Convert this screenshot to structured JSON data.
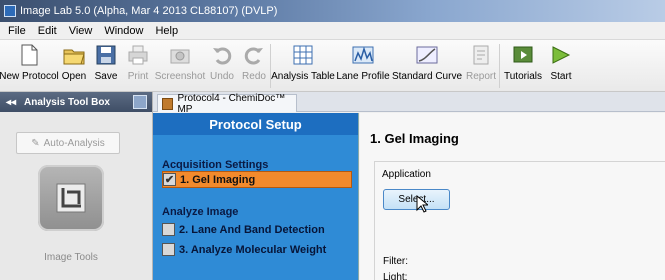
{
  "window": {
    "title": "Image Lab 5.0 (Alpha, Mar  4 2013 CL88107) (DVLP)"
  },
  "menu": [
    "File",
    "Edit",
    "View",
    "Window",
    "Help"
  ],
  "toolbar": {
    "items": [
      {
        "label": "New Protocol",
        "icon": "new-document-icon",
        "enabled": true
      },
      {
        "label": "Open",
        "icon": "open-folder-icon",
        "enabled": true
      },
      {
        "label": "Save",
        "icon": "save-icon",
        "enabled": true
      },
      {
        "label": "Print",
        "icon": "printer-icon",
        "enabled": false
      },
      {
        "label": "Screenshot",
        "icon": "camera-icon",
        "enabled": false
      },
      {
        "label": "Undo",
        "icon": "undo-icon",
        "enabled": false
      },
      {
        "label": "Redo",
        "icon": "redo-icon",
        "enabled": false
      },
      {
        "label": "Analysis Table",
        "icon": "table-icon",
        "enabled": true
      },
      {
        "label": "Lane Profile",
        "icon": "lane-profile-icon",
        "enabled": true
      },
      {
        "label": "Standard Curve",
        "icon": "standard-curve-icon",
        "enabled": true
      },
      {
        "label": "Report",
        "icon": "report-icon",
        "enabled": false
      },
      {
        "label": "Tutorials",
        "icon": "tutorials-icon",
        "enabled": true
      },
      {
        "label": "Start",
        "icon": "start-icon",
        "enabled": true
      }
    ]
  },
  "left_panel": {
    "title": "Analysis Tool Box",
    "auto_analysis": "Auto-Analysis",
    "image_tools": "Image Tools"
  },
  "doc_tab": {
    "label": "Protocol4 - ChemiDoc™ MP"
  },
  "protocol": {
    "title": "Protocol Setup",
    "acquisition_heading": "Acquisition Settings",
    "step1": "1. Gel Imaging",
    "analyze_heading": "Analyze Image",
    "step2": "2. Lane And Band Detection",
    "step3": "3. Analyze Molecular Weight"
  },
  "detail": {
    "heading": "1. Gel Imaging",
    "application_label": "Application",
    "select_button": "Select...",
    "filter_label": "Filter:",
    "light_label": "Light:"
  },
  "colors": {
    "protocol_panel": "#2f8bd6",
    "protocol_title": "#1d6ec0",
    "active_step": "#f28a2c"
  }
}
